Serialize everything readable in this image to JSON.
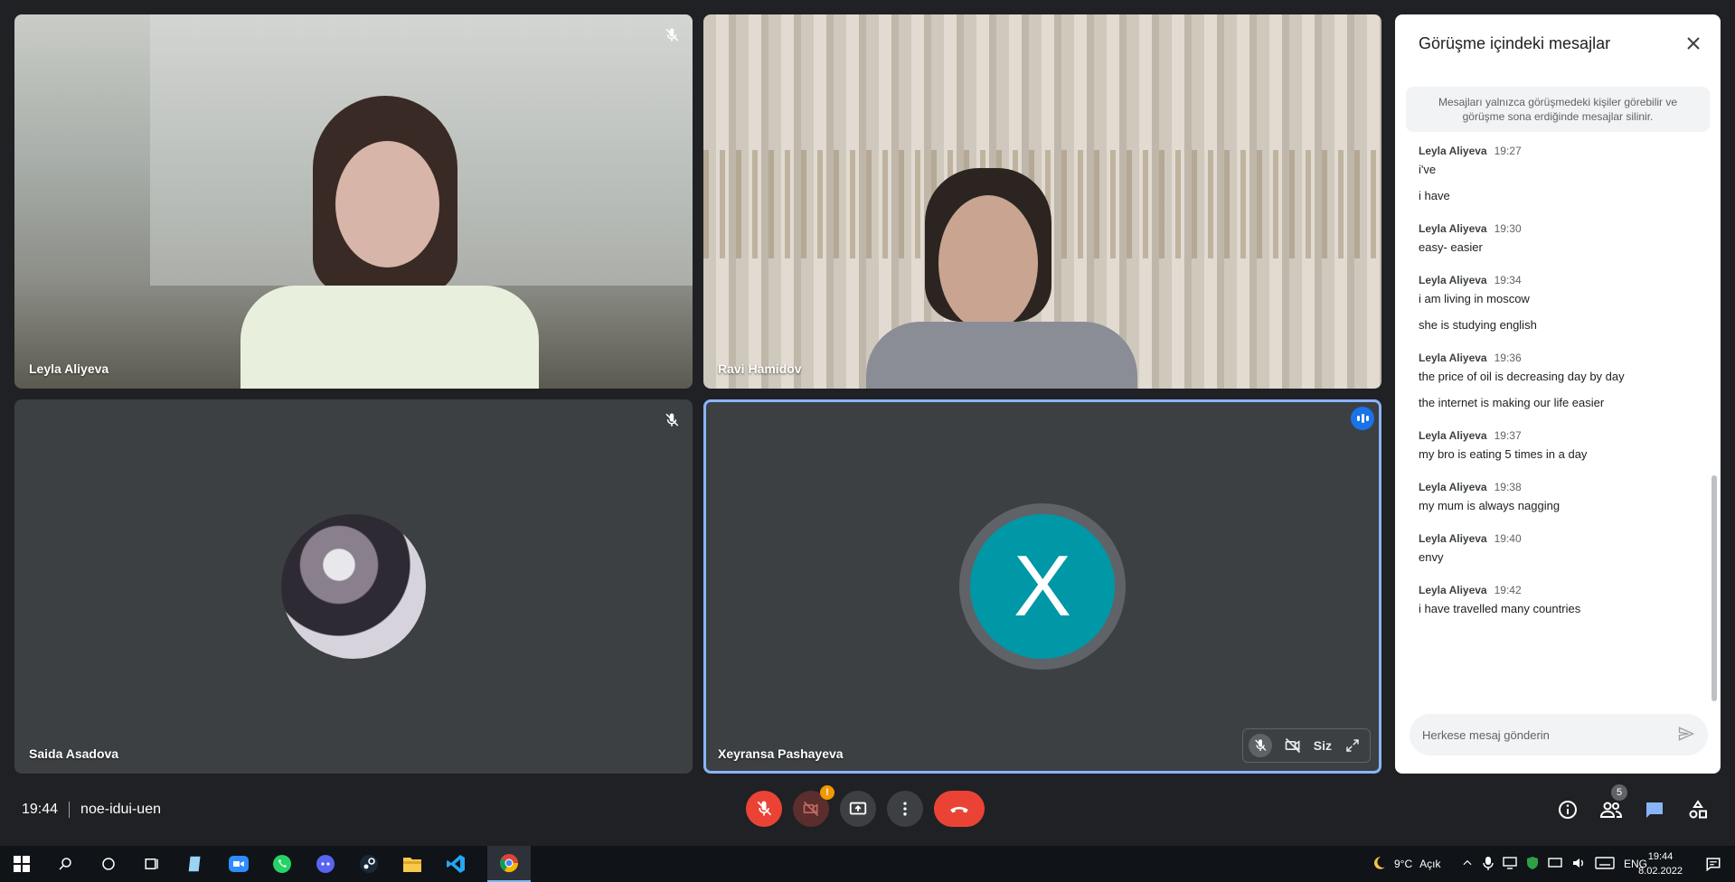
{
  "participants": [
    {
      "name": "Leyla Aliyeva",
      "mic_muted": true
    },
    {
      "name": "Ravi Hamidov",
      "mic_muted": false
    },
    {
      "name": "Saida Asadova",
      "mic_muted": true
    },
    {
      "name": "Xeyransa Pashayeva",
      "mic_muted": true,
      "avatar_letter": "X",
      "self_label": "Siz",
      "speaking": true
    }
  ],
  "chat": {
    "title": "Görüşme içindeki mesajlar",
    "notice": "Mesajları yalnızca görüşmedeki kişiler görebilir ve görüşme sona erdiğinde mesajlar silinir.",
    "input_placeholder": "Herkese mesaj gönderin",
    "messages": [
      {
        "sender": "Leyla Aliyeva",
        "time": "19:27",
        "lines": [
          "i've",
          "i have"
        ]
      },
      {
        "sender": "Leyla Aliyeva",
        "time": "19:30",
        "lines": [
          "easy- easier"
        ]
      },
      {
        "sender": "Leyla Aliyeva",
        "time": "19:34",
        "lines": [
          "i am living in moscow",
          "she is studying english"
        ]
      },
      {
        "sender": "Leyla Aliyeva",
        "time": "19:36",
        "lines": [
          "the price of oil is decreasing day by day",
          "the internet is making our life easier"
        ]
      },
      {
        "sender": "Leyla Aliyeva",
        "time": "19:37",
        "lines": [
          "my bro is eating 5 times in a day"
        ]
      },
      {
        "sender": "Leyla Aliyeva",
        "time": "19:38",
        "lines": [
          "my mum is always nagging"
        ]
      },
      {
        "sender": "Leyla Aliyeva",
        "time": "19:40",
        "lines": [
          "envy"
        ]
      },
      {
        "sender": "Leyla Aliyeva",
        "time": "19:42",
        "lines": [
          "i have travelled many countries"
        ]
      }
    ]
  },
  "meeting": {
    "time": "19:44",
    "code": "noe-idui-uen",
    "camera_warning": "!",
    "participant_count": "5"
  },
  "taskbar": {
    "weather": "9°C",
    "weather_text": "Açık",
    "language": "ENG",
    "clock_time": "19:44",
    "clock_date": "8.02.2022"
  },
  "colors": {
    "accent": "#1a73e8",
    "danger": "#ea4335",
    "avatar": "#0097a7"
  }
}
